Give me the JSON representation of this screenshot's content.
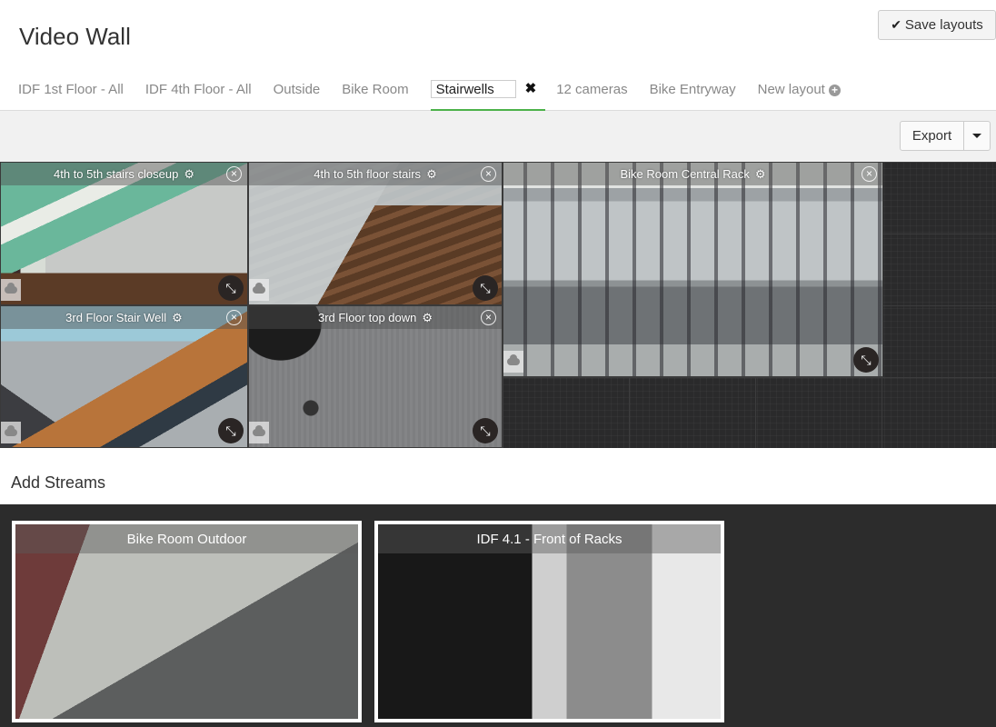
{
  "header": {
    "title": "Video Wall",
    "save_label": "Save layouts"
  },
  "tabs": [
    {
      "label": "IDF 1st Floor - All"
    },
    {
      "label": "IDF 4th Floor - All"
    },
    {
      "label": "Outside"
    },
    {
      "label": "Bike Room"
    },
    {
      "label": "Stairwells",
      "active": true,
      "editable": true
    },
    {
      "label": "12 cameras"
    },
    {
      "label": "Bike Entryway"
    },
    {
      "label": "New layout"
    }
  ],
  "toolbar": {
    "export_label": "Export"
  },
  "wall": {
    "tiles": [
      {
        "title": "4th to 5th stairs closeup"
      },
      {
        "title": "4th to 5th floor stairs"
      },
      {
        "title": "Bike Room Central Rack"
      },
      {
        "title": "3rd Floor Stair Well"
      },
      {
        "title": "3rd Floor top down"
      }
    ]
  },
  "streams": {
    "title": "Add Streams",
    "items": [
      {
        "title": "Bike Room Outdoor"
      },
      {
        "title": "IDF 4.1 - Front of Racks"
      }
    ]
  },
  "colors": {
    "active_tab_underline": "#4cb24a",
    "wall_background": "#2a2a2b",
    "toolbar_background": "#f1f1f1"
  }
}
